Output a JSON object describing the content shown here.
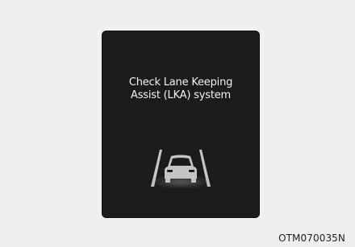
{
  "display": {
    "message_line1": "Check Lane Keeping",
    "message_line2": "Assist (LKA) system"
  },
  "icons": {
    "warning_icon": "lka-car-between-lanes-icon"
  },
  "caption": "OTM070035N",
  "colors": {
    "background": "#efefef",
    "display_bg": "#1b1b1b",
    "text": "#f2f2f2",
    "icon": "#bcbcbc"
  }
}
